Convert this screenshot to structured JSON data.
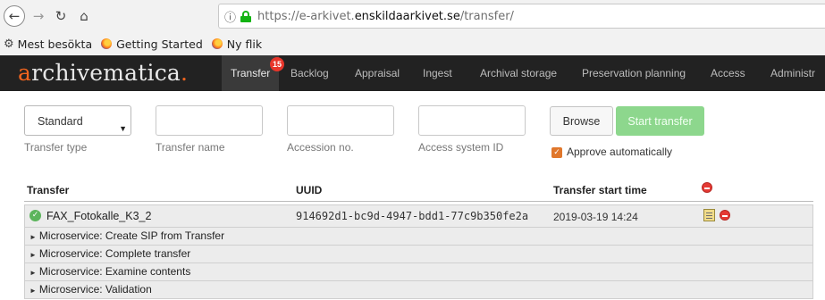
{
  "browser": {
    "nav": {
      "back": "←",
      "forward": "→",
      "reload": "↻",
      "home": "⌂"
    },
    "info_glyph": "ⓘ",
    "url_prefix": "https://e-arkivet.",
    "url_domain": "enskildaarkivet.se",
    "url_path": "/transfer/",
    "bookmarks": [
      "Mest besökta",
      "Getting Started",
      "Ny flik"
    ]
  },
  "app": {
    "brand_letter": "a",
    "brand_rest": "rchivematica",
    "brand_dot": ".",
    "tabs": [
      "Transfer",
      "Backlog",
      "Appraisal",
      "Ingest",
      "Archival storage",
      "Preservation planning",
      "Access",
      "Administr"
    ],
    "active_tab": "Transfer",
    "transfer_badge": "15"
  },
  "form": {
    "transfer_type_value": "Standard",
    "transfer_type_label": "Transfer type",
    "transfer_name_label": "Transfer name",
    "accession_label": "Accession no.",
    "access_system_label": "Access system ID",
    "browse_label": "Browse",
    "start_label": "Start transfer",
    "approve_label": "Approve automatically",
    "approve_checked": true,
    "accent_color": "#e0772b",
    "start_button_color": "#8dd78d"
  },
  "table": {
    "headers": {
      "transfer": "Transfer",
      "uuid": "UUID",
      "start_time": "Transfer start time"
    },
    "rows": [
      {
        "name": "FAX_Fotokalle_K3_2",
        "uuid": "914692d1-bc9d-4947-bdd1-77c9b350fe2a",
        "start_time": "2019-03-19 14:24",
        "status": "ok",
        "microservices": [
          "Microservice: Create SIP from Transfer",
          "Microservice: Complete transfer",
          "Microservice: Examine contents",
          "Microservice: Validation"
        ]
      }
    ]
  }
}
